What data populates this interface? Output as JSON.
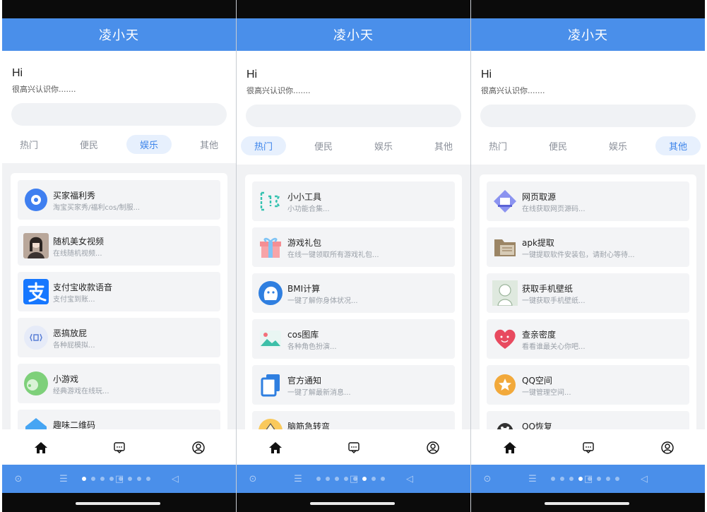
{
  "app": {
    "title": "凌小天"
  },
  "greeting": {
    "hi": "Hi",
    "subtitle": "很高兴认识你......."
  },
  "tabs": [
    "热门",
    "便民",
    "娱乐",
    "其他"
  ],
  "colors": {
    "accent": "#4a8fea",
    "active_tab_bg": "#e7f0fd",
    "active_tab_text": "#3c84ea"
  },
  "screens": [
    {
      "active_tab": "娱乐",
      "items": [
        {
          "title": "买家福利秀",
          "desc": "淘宝买家秀/福利cos/制服...",
          "icon": "chat-bubble-icon"
        },
        {
          "title": "随机美女视频",
          "desc": "在线随机视频...",
          "icon": "video-thumbnail-icon"
        },
        {
          "title": "支付宝收款语音",
          "desc": "支付宝到账...",
          "icon": "alipay-icon"
        },
        {
          "title": "恶搞放屁",
          "desc": "各种屁模拟...",
          "icon": "sound-icon"
        },
        {
          "title": "小游戏",
          "desc": "经典游戏在线玩...",
          "icon": "game-icon"
        },
        {
          "title": "趣味二维码",
          "desc": "",
          "icon": "qrcode-icon"
        }
      ]
    },
    {
      "active_tab": "热门",
      "items": [
        {
          "title": "小小工具",
          "desc": "小功能合集...",
          "icon": "tools-icon"
        },
        {
          "title": "游戏礼包",
          "desc": "在线一键领取所有游戏礼包...",
          "icon": "gift-icon"
        },
        {
          "title": "BMI计算",
          "desc": "一键了解你身体状况...",
          "icon": "bmi-icon"
        },
        {
          "title": "cos图库",
          "desc": "各种角色扮演...",
          "icon": "gallery-icon"
        },
        {
          "title": "官方通知",
          "desc": "一键了解最新消息...",
          "icon": "copy-icon"
        },
        {
          "title": "脑筋急转弯",
          "desc": "",
          "icon": "riddle-icon"
        }
      ]
    },
    {
      "active_tab": "其他",
      "items": [
        {
          "title": "网页取源",
          "desc": "在线获取网页源码...",
          "icon": "web-source-icon"
        },
        {
          "title": "apk提取",
          "desc": "一键提取软件安装包，请耐心等待...",
          "icon": "folder-icon"
        },
        {
          "title": "获取手机壁纸",
          "desc": "一键获取手机壁纸...",
          "icon": "wallpaper-icon"
        },
        {
          "title": "查亲密度",
          "desc": "看看谁最关心你吧...",
          "icon": "heart-icon"
        },
        {
          "title": "QQ空间",
          "desc": "一键管理空间...",
          "icon": "star-badge-icon"
        },
        {
          "title": "QQ恢复",
          "desc": "",
          "icon": "penguin-icon"
        }
      ]
    }
  ],
  "bottom_nav": [
    "home-icon",
    "message-icon",
    "profile-icon"
  ]
}
